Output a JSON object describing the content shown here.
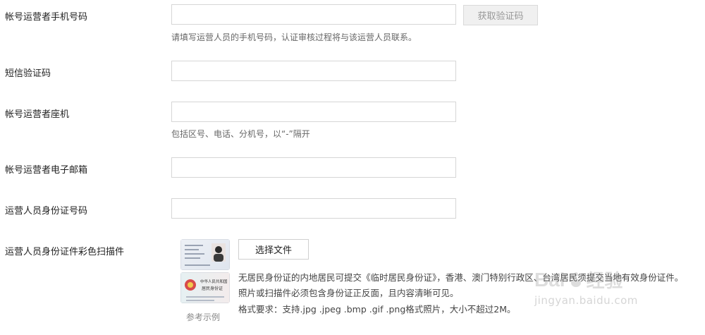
{
  "fields": {
    "phone": {
      "label": "帐号运营者手机号码",
      "value": "",
      "placeholder": "",
      "get_code": "获取验证码",
      "hint": "请填写运营人员的手机号码，认证审核过程将与该运营人员联系。"
    },
    "sms": {
      "label": "短信验证码",
      "value": "",
      "placeholder": ""
    },
    "landline": {
      "label": "帐号运营者座机",
      "value": "",
      "placeholder": "",
      "hint": "包括区号、电话、分机号，以“-”隔开"
    },
    "email": {
      "label": "帐号运营者电子邮箱",
      "value": "",
      "placeholder": ""
    },
    "idnum": {
      "label": "运营人员身份证号码",
      "value": "",
      "placeholder": ""
    }
  },
  "upload": {
    "label": "运营人员身份证件彩色扫描件",
    "choose_label": "选择文件",
    "desc1": "无居民身份证的内地居民可提交《临时居民身份证》，香港、澳门特别行政区、台湾居民须提交当地有效身份证件。",
    "desc2": "照片或扫描件必须包含身份证正反面，且内容清晰可见。",
    "desc3": "格式要求：支持.jpg .jpeg .bmp .gif .png格式照片，大小不超过2M。",
    "sample_label": "参考示例",
    "id_back_title": "中华人民共和国",
    "id_back_sub": "居民身份证"
  },
  "watermark": {
    "brand": "Bai",
    "brand_cn": "经验",
    "url": "jingyan.baidu.com"
  },
  "colors": {
    "border": "#d6d6d6",
    "disabled_bg": "#f0f0f0",
    "hint": "#666666"
  }
}
